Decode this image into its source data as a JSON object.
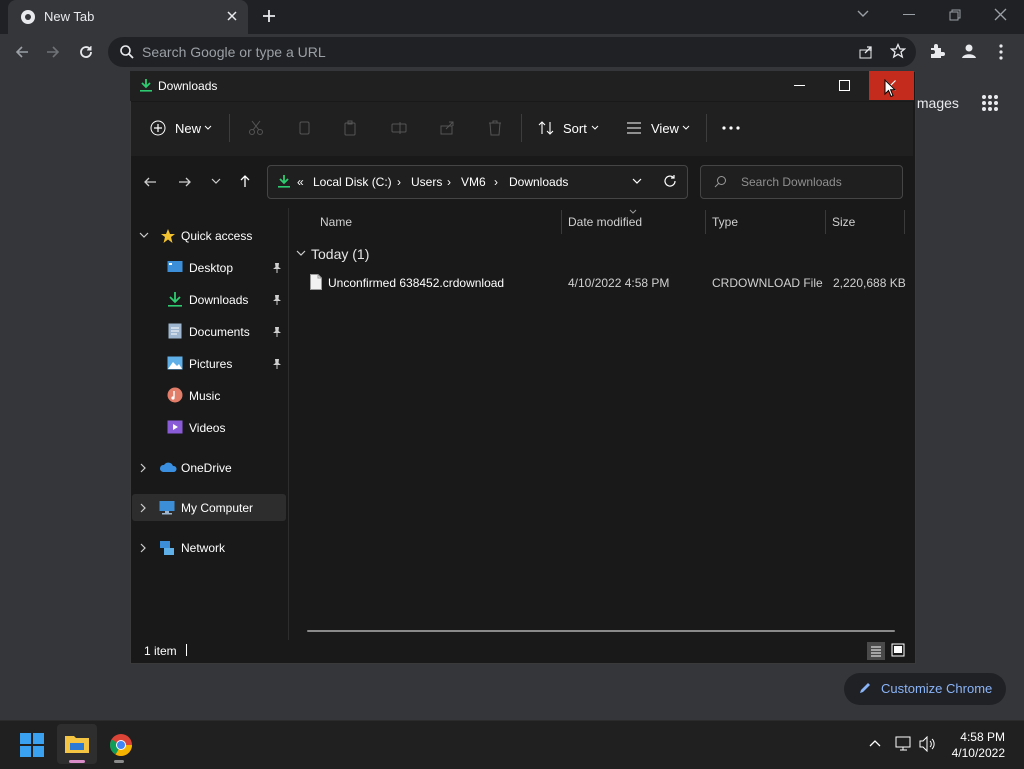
{
  "browser": {
    "tab_title": "New Tab",
    "omnibox_placeholder": "Search Google or type a URL",
    "images_link": "Images",
    "customize_label": "Customize Chrome"
  },
  "explorer": {
    "title": "Downloads",
    "toolbar": {
      "new_label": "New",
      "sort_label": "Sort",
      "view_label": "View"
    },
    "breadcrumb": [
      "Local Disk (C:)",
      "Users",
      "VM6",
      "Downloads"
    ],
    "breadcrumb_overflow": "«",
    "search_placeholder": "Search Downloads",
    "nav": {
      "quick_access": "Quick access",
      "items": [
        {
          "label": "Desktop",
          "icon": "desktop-icon"
        },
        {
          "label": "Downloads",
          "icon": "download-icon"
        },
        {
          "label": "Documents",
          "icon": "document-icon"
        },
        {
          "label": "Pictures",
          "icon": "pictures-icon"
        },
        {
          "label": "Music",
          "icon": "music-icon"
        },
        {
          "label": "Videos",
          "icon": "videos-icon"
        }
      ],
      "onedrive": "OneDrive",
      "my_computer": "My Computer",
      "network": "Network"
    },
    "columns": [
      "Name",
      "Date modified",
      "Type",
      "Size"
    ],
    "group_header": "Today (1)",
    "files": [
      {
        "name": "Unconfirmed 638452.crdownload",
        "date": "4/10/2022 4:58 PM",
        "type": "CRDOWNLOAD File",
        "size": "2,220,688 KB"
      }
    ],
    "status": "1 item"
  },
  "taskbar": {
    "time": "4:58 PM",
    "date": "4/10/2022"
  },
  "colors": {
    "close_red": "#c42b1c",
    "accent_green": "#2ecc71",
    "link_blue": "#8ab4f8"
  }
}
